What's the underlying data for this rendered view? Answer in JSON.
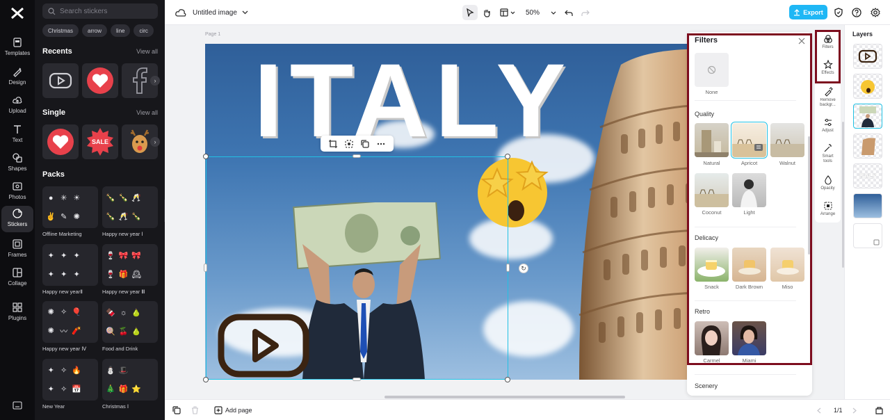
{
  "app": {
    "nav": [
      {
        "label": "Templates",
        "icon": "templates-icon"
      },
      {
        "label": "Design",
        "icon": "design-icon"
      },
      {
        "label": "Upload",
        "icon": "upload-icon"
      },
      {
        "label": "Text",
        "icon": "text-icon"
      },
      {
        "label": "Shapes",
        "icon": "shapes-icon"
      },
      {
        "label": "Photos",
        "icon": "photos-icon"
      },
      {
        "label": "Stickers",
        "icon": "stickers-icon",
        "active": true
      },
      {
        "label": "Frames",
        "icon": "frames-icon"
      },
      {
        "label": "Collage",
        "icon": "collage-icon"
      },
      {
        "label": "Plugins",
        "icon": "plugins-icon"
      }
    ]
  },
  "stickers": {
    "search_placeholder": "Search stickers",
    "chips": [
      "Christmas",
      "arrow",
      "line",
      "circ"
    ],
    "recents_title": "Recents",
    "single_title": "Single",
    "packs_title": "Packs",
    "view_all": "View all",
    "single_sale_text": "SALE",
    "packs": [
      {
        "label": "Offline Marketing",
        "glyphs": [
          "●",
          "✳",
          "☀",
          "",
          "✌",
          "✎",
          "✺",
          ""
        ]
      },
      {
        "label": "Happy new year Ⅰ",
        "glyphs": [
          "🍾",
          "🍾",
          "🥂",
          "",
          "🍾",
          "🥂",
          "🍾",
          ""
        ]
      },
      {
        "label": "Happy new yearⅡ",
        "glyphs": [
          "✦",
          "✦",
          "✦",
          "",
          "✦",
          "✦",
          "✦",
          ""
        ]
      },
      {
        "label": "Happy new year Ⅲ",
        "glyphs": [
          "🍷",
          "🎀",
          "🎀",
          "",
          "🍷",
          "🎁",
          "🕰",
          ""
        ]
      },
      {
        "label": "Happy new year Ⅳ",
        "glyphs": [
          "✺",
          "✧",
          "🎈",
          "",
          "✺",
          "〰",
          "🧨",
          ""
        ]
      },
      {
        "label": "Food and Drink",
        "glyphs": [
          "🍫",
          "☼",
          "🍐",
          "",
          "🍭",
          "🍒",
          "🍐",
          ""
        ]
      },
      {
        "label": "New Year",
        "glyphs": [
          "✦",
          "✧",
          "🔥",
          "",
          "✦",
          "✧",
          "📅",
          ""
        ]
      },
      {
        "label": "Christmas Ⅰ",
        "glyphs": [
          "⛄",
          "🎩",
          "",
          "",
          "🎄",
          "🎁",
          "⭐",
          ""
        ]
      }
    ]
  },
  "topbar": {
    "title": "Untitled image",
    "zoom": "50%",
    "export_label": "Export"
  },
  "canvas": {
    "page_label": "Page 1",
    "headline": "ITALY"
  },
  "filters": {
    "title": "Filters",
    "none_label": "None",
    "sections": {
      "quality": "Quality",
      "delicacy": "Delicacy",
      "retro": "Retro",
      "scenery": "Scenery"
    },
    "quality": [
      "Natural",
      "Apricot",
      "Walnut",
      "Coconut",
      "Light"
    ],
    "delicacy": [
      "Snack",
      "Dark Brown",
      "Miso"
    ],
    "retro": [
      "Carmel",
      "Miami"
    ]
  },
  "tools": [
    {
      "label": "Filters",
      "icon": "filters-icon",
      "active": true
    },
    {
      "label": "Effects",
      "icon": "effects-icon"
    },
    {
      "label": "Remove backgr...",
      "icon": "remove-background-icon"
    },
    {
      "label": "Adjust",
      "icon": "adjust-icon"
    },
    {
      "label": "Smart tools",
      "icon": "smart-tools-icon"
    },
    {
      "label": "Opacity",
      "icon": "opacity-icon"
    },
    {
      "label": "Arrange",
      "icon": "arrange-icon"
    }
  ],
  "layers": {
    "title": "Layers"
  },
  "bottombar": {
    "add_page": "Add page",
    "pagination": "1/1"
  },
  "colors": {
    "accent": "#1fb7f5",
    "selection": "#21c1e4",
    "highlight": "#7d0d1e",
    "rail_bg": "#0d0d10",
    "panel_bg": "#17171b"
  }
}
